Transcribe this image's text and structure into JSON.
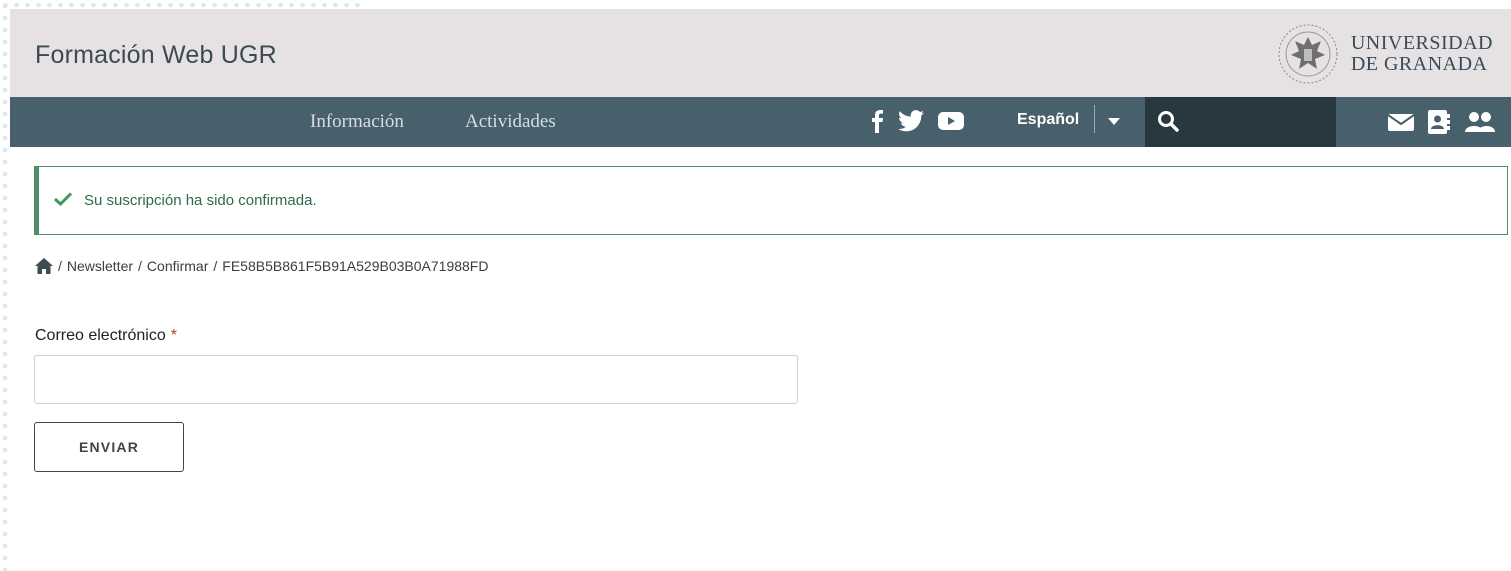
{
  "header": {
    "site_title": "Formación Web UGR",
    "university_line1": "UNIVERSIDAD",
    "university_line2": "DE GRANADA"
  },
  "nav": {
    "links": [
      "Información",
      "Actividades"
    ],
    "social_icons": [
      "facebook-icon",
      "twitter-icon",
      "youtube-icon"
    ],
    "language": "Español",
    "right_icons": [
      "mail-icon",
      "contact-card-icon",
      "users-icon"
    ]
  },
  "alert": {
    "message": "Su suscripción ha sido confirmada."
  },
  "breadcrumb": {
    "items": [
      "Newsletter",
      "Confirmar",
      "FE58B5B861F5B91A529B03B0A71988FD"
    ]
  },
  "form": {
    "email_label": "Correo electrónico",
    "required_mark": "*",
    "email_value": "",
    "submit_label": "ENVIAR"
  },
  "colors": {
    "header_bg": "#e6e2e3",
    "nav_bg": "#47606c",
    "search_bg": "#283840",
    "success": "#4f8f68"
  }
}
